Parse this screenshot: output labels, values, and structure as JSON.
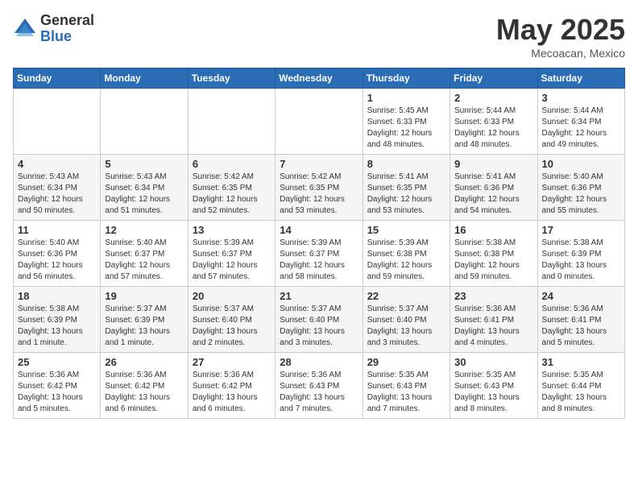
{
  "logo": {
    "general": "General",
    "blue": "Blue"
  },
  "title": {
    "month_year": "May 2025",
    "location": "Mecoacan, Mexico"
  },
  "weekdays": [
    "Sunday",
    "Monday",
    "Tuesday",
    "Wednesday",
    "Thursday",
    "Friday",
    "Saturday"
  ],
  "weeks": [
    [
      {
        "day": "",
        "info": ""
      },
      {
        "day": "",
        "info": ""
      },
      {
        "day": "",
        "info": ""
      },
      {
        "day": "",
        "info": ""
      },
      {
        "day": "1",
        "info": "Sunrise: 5:45 AM\nSunset: 6:33 PM\nDaylight: 12 hours\nand 48 minutes."
      },
      {
        "day": "2",
        "info": "Sunrise: 5:44 AM\nSunset: 6:33 PM\nDaylight: 12 hours\nand 48 minutes."
      },
      {
        "day": "3",
        "info": "Sunrise: 5:44 AM\nSunset: 6:34 PM\nDaylight: 12 hours\nand 49 minutes."
      }
    ],
    [
      {
        "day": "4",
        "info": "Sunrise: 5:43 AM\nSunset: 6:34 PM\nDaylight: 12 hours\nand 50 minutes."
      },
      {
        "day": "5",
        "info": "Sunrise: 5:43 AM\nSunset: 6:34 PM\nDaylight: 12 hours\nand 51 minutes."
      },
      {
        "day": "6",
        "info": "Sunrise: 5:42 AM\nSunset: 6:35 PM\nDaylight: 12 hours\nand 52 minutes."
      },
      {
        "day": "7",
        "info": "Sunrise: 5:42 AM\nSunset: 6:35 PM\nDaylight: 12 hours\nand 53 minutes."
      },
      {
        "day": "8",
        "info": "Sunrise: 5:41 AM\nSunset: 6:35 PM\nDaylight: 12 hours\nand 53 minutes."
      },
      {
        "day": "9",
        "info": "Sunrise: 5:41 AM\nSunset: 6:36 PM\nDaylight: 12 hours\nand 54 minutes."
      },
      {
        "day": "10",
        "info": "Sunrise: 5:40 AM\nSunset: 6:36 PM\nDaylight: 12 hours\nand 55 minutes."
      }
    ],
    [
      {
        "day": "11",
        "info": "Sunrise: 5:40 AM\nSunset: 6:36 PM\nDaylight: 12 hours\nand 56 minutes."
      },
      {
        "day": "12",
        "info": "Sunrise: 5:40 AM\nSunset: 6:37 PM\nDaylight: 12 hours\nand 57 minutes."
      },
      {
        "day": "13",
        "info": "Sunrise: 5:39 AM\nSunset: 6:37 PM\nDaylight: 12 hours\nand 57 minutes."
      },
      {
        "day": "14",
        "info": "Sunrise: 5:39 AM\nSunset: 6:37 PM\nDaylight: 12 hours\nand 58 minutes."
      },
      {
        "day": "15",
        "info": "Sunrise: 5:39 AM\nSunset: 6:38 PM\nDaylight: 12 hours\nand 59 minutes."
      },
      {
        "day": "16",
        "info": "Sunrise: 5:38 AM\nSunset: 6:38 PM\nDaylight: 12 hours\nand 59 minutes."
      },
      {
        "day": "17",
        "info": "Sunrise: 5:38 AM\nSunset: 6:39 PM\nDaylight: 13 hours\nand 0 minutes."
      }
    ],
    [
      {
        "day": "18",
        "info": "Sunrise: 5:38 AM\nSunset: 6:39 PM\nDaylight: 13 hours\nand 1 minute."
      },
      {
        "day": "19",
        "info": "Sunrise: 5:37 AM\nSunset: 6:39 PM\nDaylight: 13 hours\nand 1 minute."
      },
      {
        "day": "20",
        "info": "Sunrise: 5:37 AM\nSunset: 6:40 PM\nDaylight: 13 hours\nand 2 minutes."
      },
      {
        "day": "21",
        "info": "Sunrise: 5:37 AM\nSunset: 6:40 PM\nDaylight: 13 hours\nand 3 minutes."
      },
      {
        "day": "22",
        "info": "Sunrise: 5:37 AM\nSunset: 6:40 PM\nDaylight: 13 hours\nand 3 minutes."
      },
      {
        "day": "23",
        "info": "Sunrise: 5:36 AM\nSunset: 6:41 PM\nDaylight: 13 hours\nand 4 minutes."
      },
      {
        "day": "24",
        "info": "Sunrise: 5:36 AM\nSunset: 6:41 PM\nDaylight: 13 hours\nand 5 minutes."
      }
    ],
    [
      {
        "day": "25",
        "info": "Sunrise: 5:36 AM\nSunset: 6:42 PM\nDaylight: 13 hours\nand 5 minutes."
      },
      {
        "day": "26",
        "info": "Sunrise: 5:36 AM\nSunset: 6:42 PM\nDaylight: 13 hours\nand 6 minutes."
      },
      {
        "day": "27",
        "info": "Sunrise: 5:36 AM\nSunset: 6:42 PM\nDaylight: 13 hours\nand 6 minutes."
      },
      {
        "day": "28",
        "info": "Sunrise: 5:36 AM\nSunset: 6:43 PM\nDaylight: 13 hours\nand 7 minutes."
      },
      {
        "day": "29",
        "info": "Sunrise: 5:35 AM\nSunset: 6:43 PM\nDaylight: 13 hours\nand 7 minutes."
      },
      {
        "day": "30",
        "info": "Sunrise: 5:35 AM\nSunset: 6:43 PM\nDaylight: 13 hours\nand 8 minutes."
      },
      {
        "day": "31",
        "info": "Sunrise: 5:35 AM\nSunset: 6:44 PM\nDaylight: 13 hours\nand 8 minutes."
      }
    ]
  ]
}
